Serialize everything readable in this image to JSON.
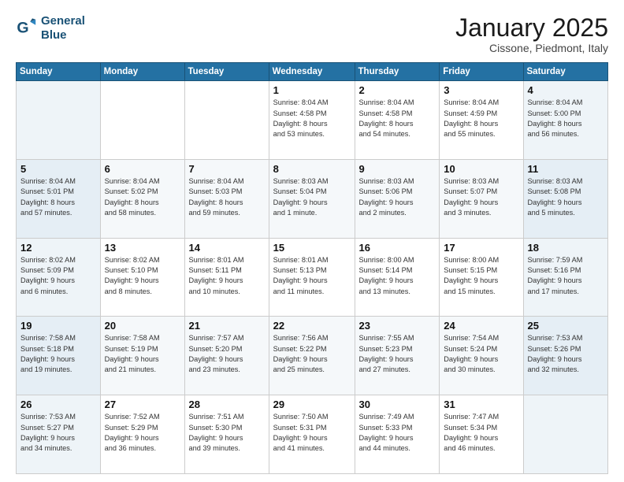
{
  "logo": {
    "line1": "General",
    "line2": "Blue"
  },
  "title": "January 2025",
  "subtitle": "Cissone, Piedmont, Italy",
  "weekdays": [
    "Sunday",
    "Monday",
    "Tuesday",
    "Wednesday",
    "Thursday",
    "Friday",
    "Saturday"
  ],
  "weeks": [
    [
      {
        "day": "",
        "info": ""
      },
      {
        "day": "",
        "info": ""
      },
      {
        "day": "",
        "info": ""
      },
      {
        "day": "1",
        "info": "Sunrise: 8:04 AM\nSunset: 4:58 PM\nDaylight: 8 hours\nand 53 minutes."
      },
      {
        "day": "2",
        "info": "Sunrise: 8:04 AM\nSunset: 4:58 PM\nDaylight: 8 hours\nand 54 minutes."
      },
      {
        "day": "3",
        "info": "Sunrise: 8:04 AM\nSunset: 4:59 PM\nDaylight: 8 hours\nand 55 minutes."
      },
      {
        "day": "4",
        "info": "Sunrise: 8:04 AM\nSunset: 5:00 PM\nDaylight: 8 hours\nand 56 minutes."
      }
    ],
    [
      {
        "day": "5",
        "info": "Sunrise: 8:04 AM\nSunset: 5:01 PM\nDaylight: 8 hours\nand 57 minutes."
      },
      {
        "day": "6",
        "info": "Sunrise: 8:04 AM\nSunset: 5:02 PM\nDaylight: 8 hours\nand 58 minutes."
      },
      {
        "day": "7",
        "info": "Sunrise: 8:04 AM\nSunset: 5:03 PM\nDaylight: 8 hours\nand 59 minutes."
      },
      {
        "day": "8",
        "info": "Sunrise: 8:03 AM\nSunset: 5:04 PM\nDaylight: 9 hours\nand 1 minute."
      },
      {
        "day": "9",
        "info": "Sunrise: 8:03 AM\nSunset: 5:06 PM\nDaylight: 9 hours\nand 2 minutes."
      },
      {
        "day": "10",
        "info": "Sunrise: 8:03 AM\nSunset: 5:07 PM\nDaylight: 9 hours\nand 3 minutes."
      },
      {
        "day": "11",
        "info": "Sunrise: 8:03 AM\nSunset: 5:08 PM\nDaylight: 9 hours\nand 5 minutes."
      }
    ],
    [
      {
        "day": "12",
        "info": "Sunrise: 8:02 AM\nSunset: 5:09 PM\nDaylight: 9 hours\nand 6 minutes."
      },
      {
        "day": "13",
        "info": "Sunrise: 8:02 AM\nSunset: 5:10 PM\nDaylight: 9 hours\nand 8 minutes."
      },
      {
        "day": "14",
        "info": "Sunrise: 8:01 AM\nSunset: 5:11 PM\nDaylight: 9 hours\nand 10 minutes."
      },
      {
        "day": "15",
        "info": "Sunrise: 8:01 AM\nSunset: 5:13 PM\nDaylight: 9 hours\nand 11 minutes."
      },
      {
        "day": "16",
        "info": "Sunrise: 8:00 AM\nSunset: 5:14 PM\nDaylight: 9 hours\nand 13 minutes."
      },
      {
        "day": "17",
        "info": "Sunrise: 8:00 AM\nSunset: 5:15 PM\nDaylight: 9 hours\nand 15 minutes."
      },
      {
        "day": "18",
        "info": "Sunrise: 7:59 AM\nSunset: 5:16 PM\nDaylight: 9 hours\nand 17 minutes."
      }
    ],
    [
      {
        "day": "19",
        "info": "Sunrise: 7:58 AM\nSunset: 5:18 PM\nDaylight: 9 hours\nand 19 minutes."
      },
      {
        "day": "20",
        "info": "Sunrise: 7:58 AM\nSunset: 5:19 PM\nDaylight: 9 hours\nand 21 minutes."
      },
      {
        "day": "21",
        "info": "Sunrise: 7:57 AM\nSunset: 5:20 PM\nDaylight: 9 hours\nand 23 minutes."
      },
      {
        "day": "22",
        "info": "Sunrise: 7:56 AM\nSunset: 5:22 PM\nDaylight: 9 hours\nand 25 minutes."
      },
      {
        "day": "23",
        "info": "Sunrise: 7:55 AM\nSunset: 5:23 PM\nDaylight: 9 hours\nand 27 minutes."
      },
      {
        "day": "24",
        "info": "Sunrise: 7:54 AM\nSunset: 5:24 PM\nDaylight: 9 hours\nand 30 minutes."
      },
      {
        "day": "25",
        "info": "Sunrise: 7:53 AM\nSunset: 5:26 PM\nDaylight: 9 hours\nand 32 minutes."
      }
    ],
    [
      {
        "day": "26",
        "info": "Sunrise: 7:53 AM\nSunset: 5:27 PM\nDaylight: 9 hours\nand 34 minutes."
      },
      {
        "day": "27",
        "info": "Sunrise: 7:52 AM\nSunset: 5:29 PM\nDaylight: 9 hours\nand 36 minutes."
      },
      {
        "day": "28",
        "info": "Sunrise: 7:51 AM\nSunset: 5:30 PM\nDaylight: 9 hours\nand 39 minutes."
      },
      {
        "day": "29",
        "info": "Sunrise: 7:50 AM\nSunset: 5:31 PM\nDaylight: 9 hours\nand 41 minutes."
      },
      {
        "day": "30",
        "info": "Sunrise: 7:49 AM\nSunset: 5:33 PM\nDaylight: 9 hours\nand 44 minutes."
      },
      {
        "day": "31",
        "info": "Sunrise: 7:47 AM\nSunset: 5:34 PM\nDaylight: 9 hours\nand 46 minutes."
      },
      {
        "day": "",
        "info": ""
      }
    ]
  ]
}
